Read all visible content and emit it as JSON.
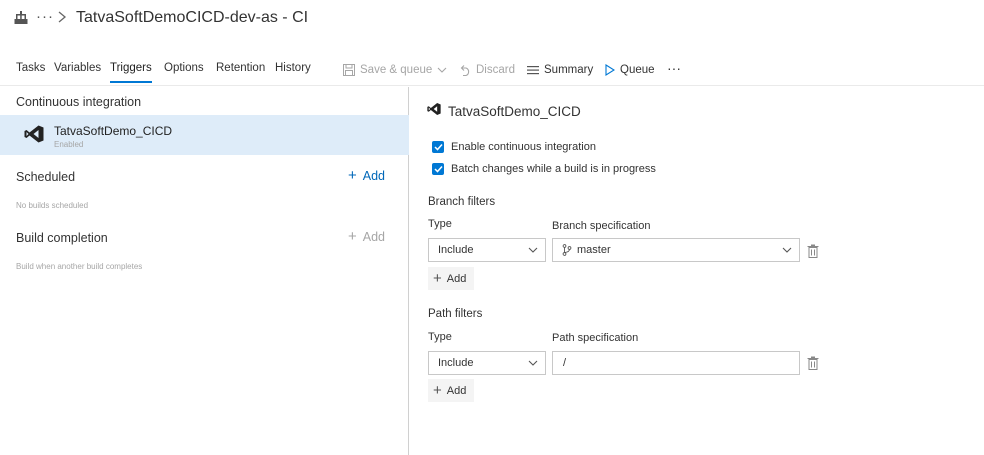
{
  "header": {
    "breadcrumb_more": "···",
    "title": "TatvaSoftDemoCICD-dev-as - CI"
  },
  "tabs": [
    {
      "label": "Tasks"
    },
    {
      "label": "Variables"
    },
    {
      "label": "Triggers",
      "active": true
    },
    {
      "label": "Options"
    },
    {
      "label": "Retention"
    },
    {
      "label": "History"
    }
  ],
  "commands": {
    "save_queue": "Save & queue",
    "discard": "Discard",
    "summary": "Summary",
    "queue": "Queue",
    "more": "···"
  },
  "left": {
    "ci": {
      "title": "Continuous integration",
      "item_name": "TatvaSoftDemo_CICD",
      "item_status": "Enabled"
    },
    "scheduled": {
      "title": "Scheduled",
      "add": "Add",
      "note": "No builds scheduled"
    },
    "build_completion": {
      "title": "Build completion",
      "add": "Add",
      "note": "Build when another build completes"
    }
  },
  "right": {
    "title": "TatvaSoftDemo_CICD",
    "enable_ci": "Enable continuous integration",
    "enable_ci_checked": true,
    "batch_changes": "Batch changes while a build is in progress",
    "batch_changes_checked": true,
    "branch_filters": {
      "title": "Branch filters",
      "type_label": "Type",
      "spec_label": "Branch specification",
      "type_value": "Include",
      "spec_value": "master",
      "add": "Add"
    },
    "path_filters": {
      "title": "Path filters",
      "type_label": "Type",
      "spec_label": "Path specification",
      "type_value": "Include",
      "spec_value": "/",
      "add": "Add"
    }
  },
  "colors": {
    "accent": "#0078d4",
    "selected_row": "#deecf9",
    "link": "#0067b8",
    "disabled": "#a6a6a6"
  }
}
